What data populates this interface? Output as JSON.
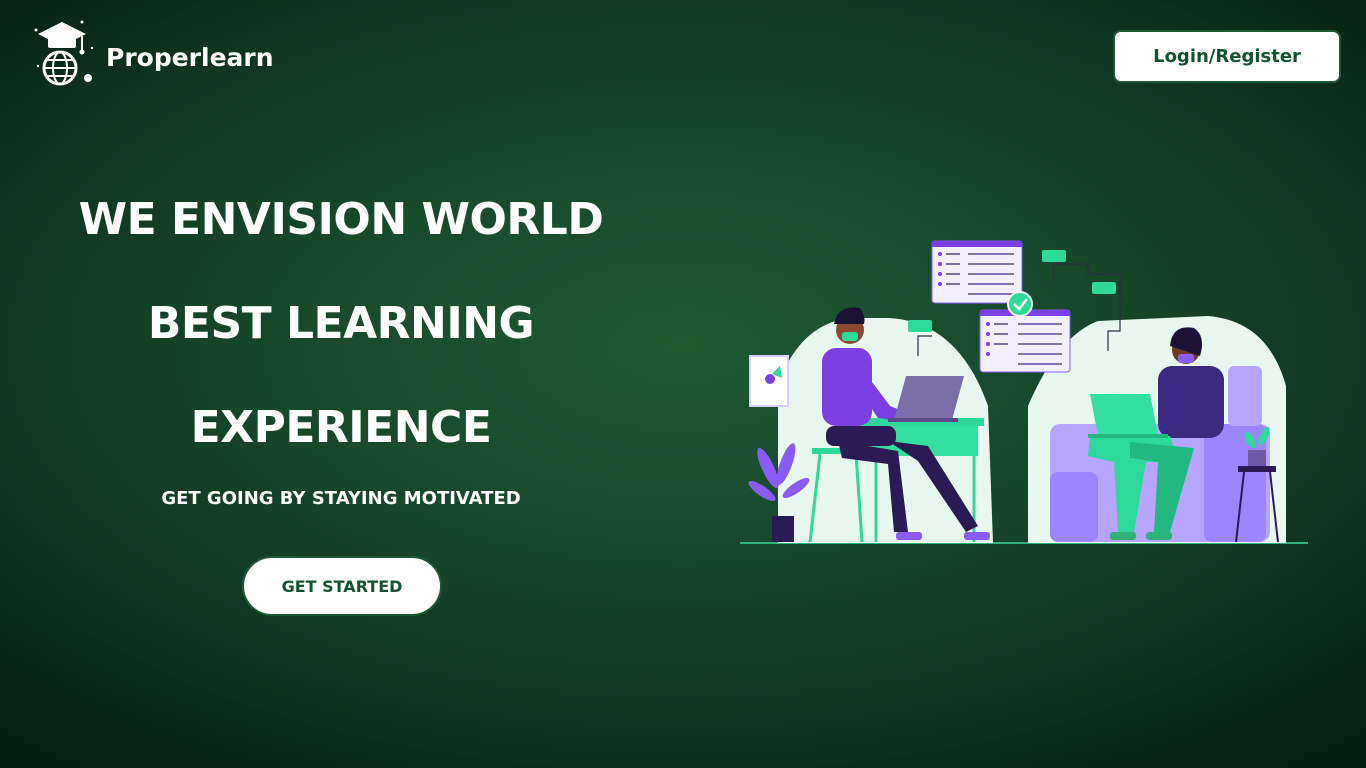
{
  "header": {
    "brand": "Properlearn",
    "login_label": "Login/Register"
  },
  "hero": {
    "lines": [
      "WE ENVISION WORLD",
      "BEST LEARNING",
      "EXPERIENCE"
    ],
    "tagline": "GET GOING BY STAYING MOTIVATED",
    "cta_label": "GET STARTED"
  },
  "icons": {
    "logo": "graduation-cap-globe-icon",
    "illustration": "people-working-on-laptops-illustration"
  },
  "colors": {
    "background": "#17472a",
    "button_text": "#14532d",
    "accent_green": "#2fd99a",
    "accent_purple": "#7b3fe4"
  }
}
